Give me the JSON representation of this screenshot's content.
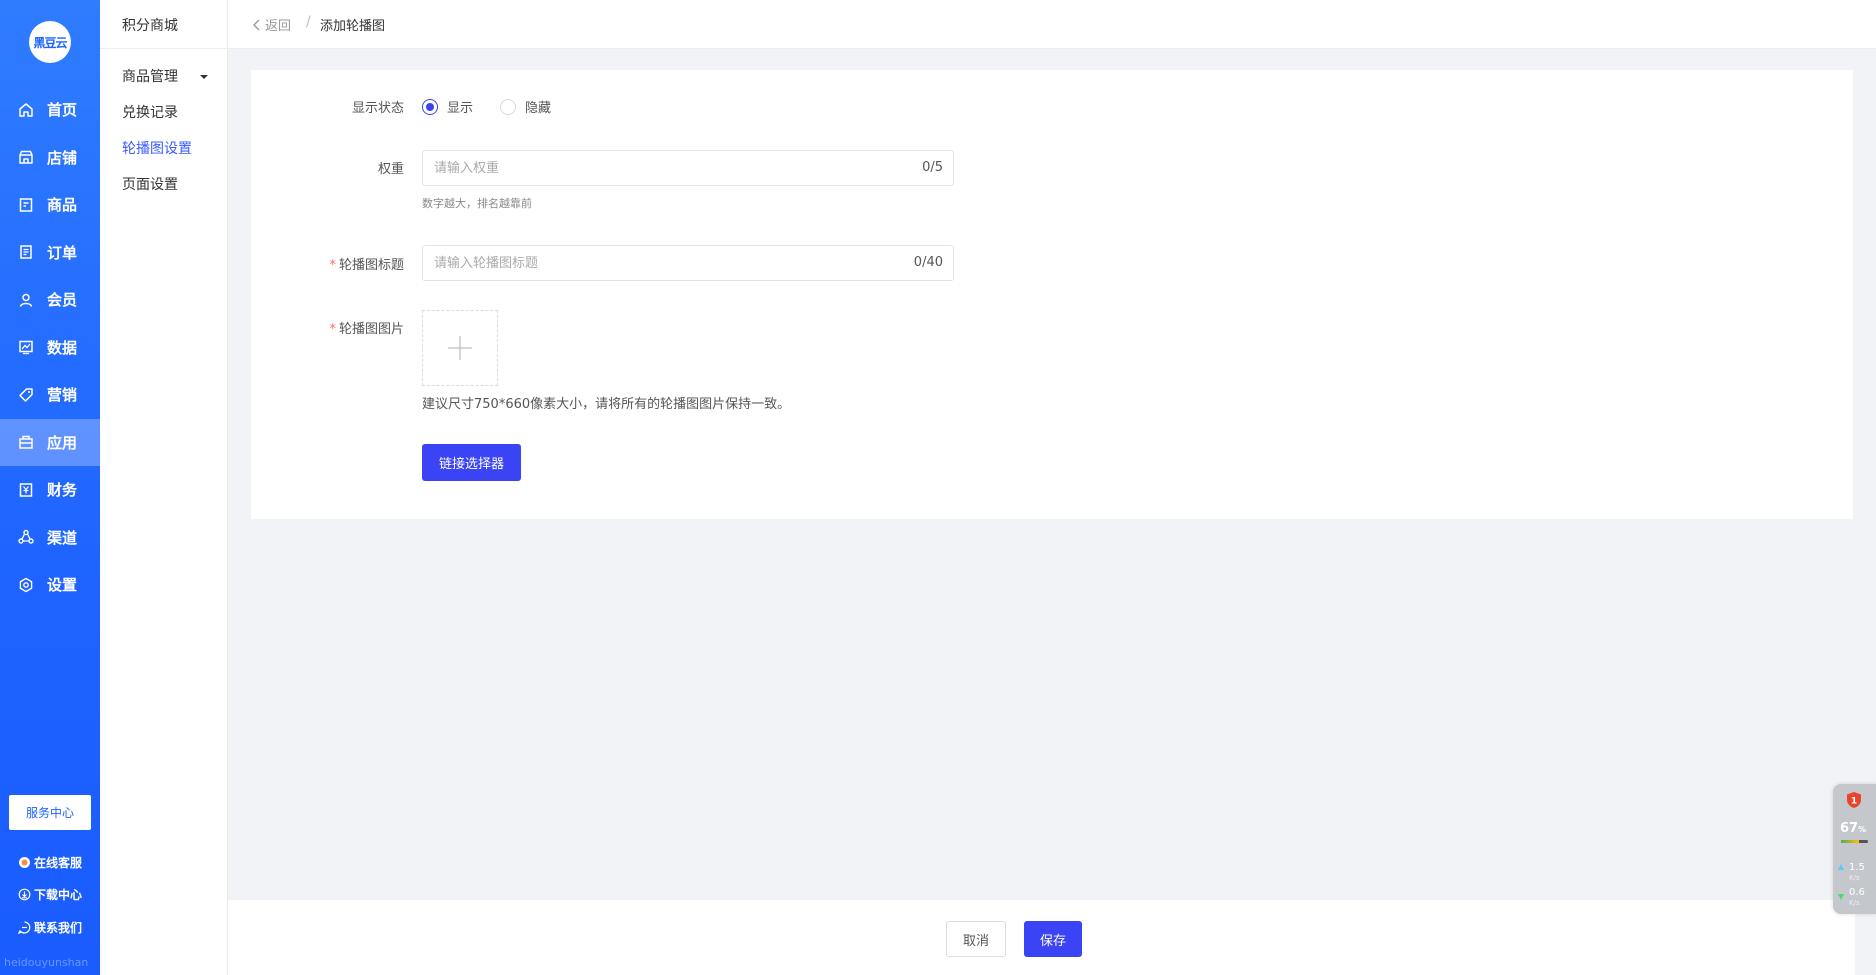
{
  "app": {
    "logo_text": "黑豆云",
    "watermark": "heidouyunshan"
  },
  "sidebar": {
    "items": [
      {
        "label": "首页",
        "icon": "home-icon"
      },
      {
        "label": "店铺",
        "icon": "store-icon"
      },
      {
        "label": "商品",
        "icon": "goods-icon"
      },
      {
        "label": "订单",
        "icon": "order-icon"
      },
      {
        "label": "会员",
        "icon": "member-icon"
      },
      {
        "label": "数据",
        "icon": "chart-icon"
      },
      {
        "label": "营销",
        "icon": "tag-icon"
      },
      {
        "label": "应用",
        "icon": "app-icon"
      },
      {
        "label": "财务",
        "icon": "finance-icon"
      },
      {
        "label": "渠道",
        "icon": "channel-icon"
      },
      {
        "label": "设置",
        "icon": "gear-icon"
      }
    ],
    "active_index": 7,
    "service_center": "服务中心",
    "links": [
      {
        "label": "在线客服",
        "icon": "customer-service-icon"
      },
      {
        "label": "下载中心",
        "icon": "download-icon"
      },
      {
        "label": "联系我们",
        "icon": "chat-icon"
      }
    ]
  },
  "subnav": {
    "title": "积分商城",
    "items": [
      {
        "label": "商品管理"
      },
      {
        "label": "兑换记录"
      },
      {
        "label": "轮播图设置"
      },
      {
        "label": "页面设置"
      }
    ],
    "active_index": 2
  },
  "header": {
    "back_label": "返回",
    "separator": "/",
    "breadcrumb": "添加轮播图"
  },
  "form": {
    "display_status": {
      "label": "显示状态",
      "options": [
        "显示",
        "隐藏"
      ],
      "selected": "显示"
    },
    "weight": {
      "label": "权重",
      "placeholder": "请输入权重",
      "value": "",
      "count": "0/5",
      "hint": "数字越大，排名越靠前"
    },
    "title": {
      "label": "轮播图标题",
      "placeholder": "请输入轮播图标题",
      "value": "",
      "count": "0/40",
      "required_mark": "*"
    },
    "image": {
      "label": "轮播图图片",
      "required_mark": "*",
      "hint": "建议尺寸750*660像素大小，请将所有的轮播图图片保持一致。"
    },
    "link_selector_label": "链接选择器"
  },
  "footer": {
    "cancel_label": "取消",
    "save_label": "保存"
  },
  "widget": {
    "badge": "1",
    "percent": "67",
    "percent_unit": "%",
    "upload_speed": "1.5",
    "download_speed": "0.6",
    "speed_unit": "K/s",
    "percent_fill": 0.67
  },
  "colors": {
    "sidebar_bg": "#1e63ff",
    "primary": "#3b44f5",
    "active_link": "#3b5bfd",
    "required": "#f56c6c",
    "page_bg": "#f2f3f7"
  }
}
